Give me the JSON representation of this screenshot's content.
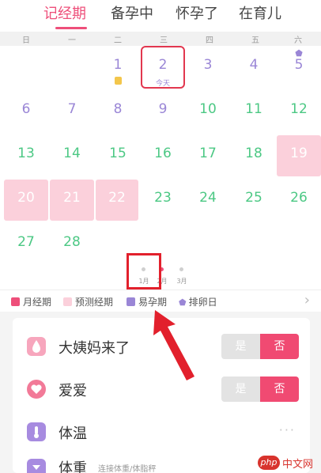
{
  "tabs": [
    {
      "label": "记经期",
      "active": true
    },
    {
      "label": "备孕中",
      "active": false
    },
    {
      "label": "怀孕了",
      "active": false
    },
    {
      "label": "在育儿",
      "active": false
    }
  ],
  "weekdays": [
    "日",
    "一",
    "二",
    "三",
    "四",
    "五",
    "六"
  ],
  "today_label": "今天",
  "days": [
    {
      "n": "1"
    },
    {
      "n": "2"
    },
    {
      "n": "3"
    },
    {
      "n": "4"
    },
    {
      "n": "5"
    },
    {
      "n": "6"
    },
    {
      "n": "7"
    },
    {
      "n": "8"
    },
    {
      "n": "9"
    },
    {
      "n": "10"
    },
    {
      "n": "11"
    },
    {
      "n": "12"
    },
    {
      "n": "13"
    },
    {
      "n": "14"
    },
    {
      "n": "15"
    },
    {
      "n": "16"
    },
    {
      "n": "17"
    },
    {
      "n": "18"
    },
    {
      "n": "19"
    },
    {
      "n": "20"
    },
    {
      "n": "21"
    },
    {
      "n": "22"
    },
    {
      "n": "23"
    },
    {
      "n": "24"
    },
    {
      "n": "25"
    },
    {
      "n": "26"
    },
    {
      "n": "27"
    },
    {
      "n": "28"
    }
  ],
  "months": [
    "1月",
    "2月",
    "3月"
  ],
  "legend": [
    {
      "label": "月经期",
      "color": "#ee4f7a"
    },
    {
      "label": "预测经期",
      "color": "#fbd0db"
    },
    {
      "label": "易孕期",
      "color": "#9a86d6"
    },
    {
      "label": "排卵日",
      "color": "#9a86d6"
    }
  ],
  "rows": [
    {
      "label": "大姨妈来了",
      "yes": "是",
      "no": "否"
    },
    {
      "label": "爱爱",
      "yes": "是",
      "no": "否"
    },
    {
      "label": "体温",
      "more": "···"
    },
    {
      "label": "体重",
      "sub": "连接体重/体脂秤"
    }
  ],
  "watermark": {
    "badge": "php",
    "text": "中文网"
  },
  "colors": {
    "accent": "#ee4f7a",
    "annotation": "#e2202c"
  }
}
